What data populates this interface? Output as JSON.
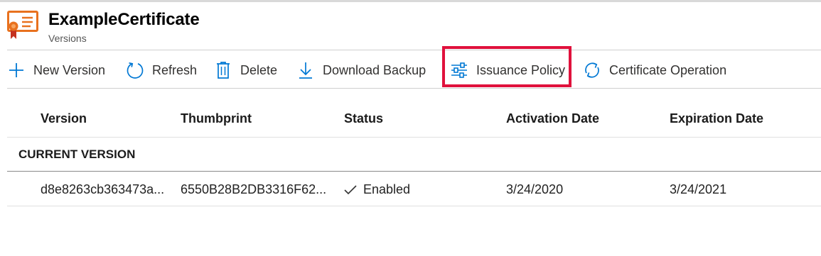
{
  "header": {
    "title": "ExampleCertificate",
    "subtitle": "Versions",
    "icon": "certificate-icon"
  },
  "toolbar": {
    "buttons": [
      {
        "label": "New Version",
        "icon": "plus-icon"
      },
      {
        "label": "Refresh",
        "icon": "refresh-icon"
      },
      {
        "label": "Delete",
        "icon": "trash-icon"
      },
      {
        "label": "Download Backup",
        "icon": "download-icon"
      },
      {
        "label": "Issuance Policy",
        "icon": "sliders-icon",
        "highlighted": true
      },
      {
        "label": "Certificate Operation",
        "icon": "sync-icon"
      }
    ],
    "highlight_color": "#e0113c"
  },
  "table": {
    "columns": [
      "Version",
      "Thumbprint",
      "Status",
      "Activation Date",
      "Expiration Date"
    ],
    "groups": [
      {
        "label": "CURRENT VERSION",
        "rows": [
          {
            "version": "d8e8263cb363473a...",
            "thumbprint": "6550B28B2DB3316F62...",
            "status": "Enabled",
            "activation_date": "3/24/2020",
            "expiration_date": "3/24/2021"
          }
        ]
      }
    ]
  },
  "colors": {
    "accent": "#0078d4",
    "icon_orange": "#e8711e"
  }
}
